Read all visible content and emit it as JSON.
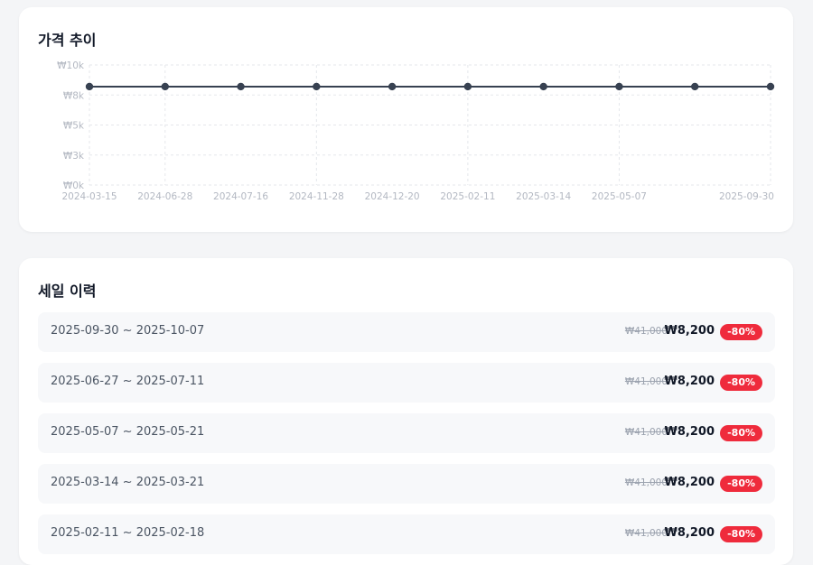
{
  "price_trend": {
    "title": "가격 추이",
    "colors": {
      "line": "#374151",
      "grid": "#e5e7eb"
    },
    "chart_data": {
      "type": "line",
      "title": "",
      "xlabel": "",
      "ylabel": "",
      "x_tick_labels": [
        "2024-03-15",
        "2024-06-28",
        "2024-07-16",
        "2024-11-28",
        "2024-12-20",
        "2025-02-11",
        "2025-03-14",
        "2025-05-07",
        "2025-09-30"
      ],
      "y_tick_labels": [
        "₩10k",
        "₩8k",
        "₩5k",
        "₩3k",
        "₩0k"
      ],
      "y_tick_values": [
        10000,
        8000,
        5000,
        3000,
        0
      ],
      "ylim": [
        0,
        10000
      ],
      "grid": true,
      "series": [
        {
          "values": [
            8200,
            8200,
            8200,
            8200,
            8200,
            8200,
            8200,
            8200,
            8200,
            8200
          ]
        }
      ]
    }
  },
  "sale_history": {
    "title": "세일 이력",
    "badge_color": "#ef2b3c",
    "items": [
      {
        "range": "2025-09-30 ~ 2025-10-07",
        "original": "₩41,000",
        "price": "₩8,200",
        "discount": "-80%"
      },
      {
        "range": "2025-06-27 ~ 2025-07-11",
        "original": "₩41,000",
        "price": "₩8,200",
        "discount": "-80%"
      },
      {
        "range": "2025-05-07 ~ 2025-05-21",
        "original": "₩41,000",
        "price": "₩8,200",
        "discount": "-80%"
      },
      {
        "range": "2025-03-14 ~ 2025-03-21",
        "original": "₩41,000",
        "price": "₩8,200",
        "discount": "-80%"
      },
      {
        "range": "2025-02-11 ~ 2025-02-18",
        "original": "₩41,000",
        "price": "₩8,200",
        "discount": "-80%"
      }
    ]
  }
}
